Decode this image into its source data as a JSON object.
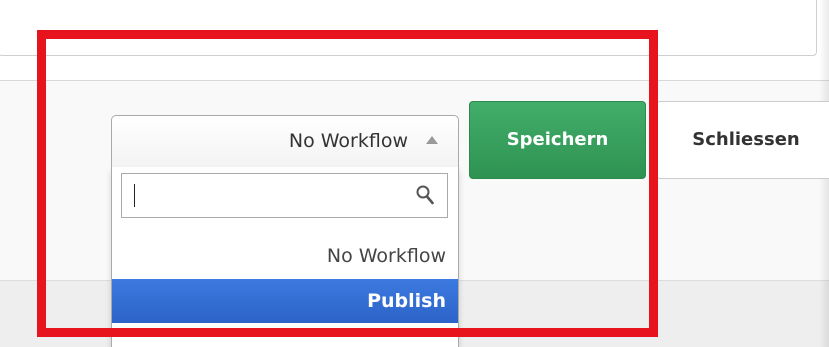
{
  "workflow_select": {
    "selected_value": "No Workflow",
    "arrow_icon": "triangle-up-icon",
    "search": {
      "value": "",
      "placeholder": "",
      "icon": "search-icon"
    },
    "options": [
      {
        "label": "No Workflow",
        "highlighted": false
      },
      {
        "label": "Publish",
        "highlighted": true
      }
    ]
  },
  "actions": {
    "save_label": "Speichern",
    "close_label": "Schliessen"
  },
  "colors": {
    "save_button": "#33a05c",
    "option_highlight": "#3470d6",
    "annotation_border": "#e8141d"
  }
}
